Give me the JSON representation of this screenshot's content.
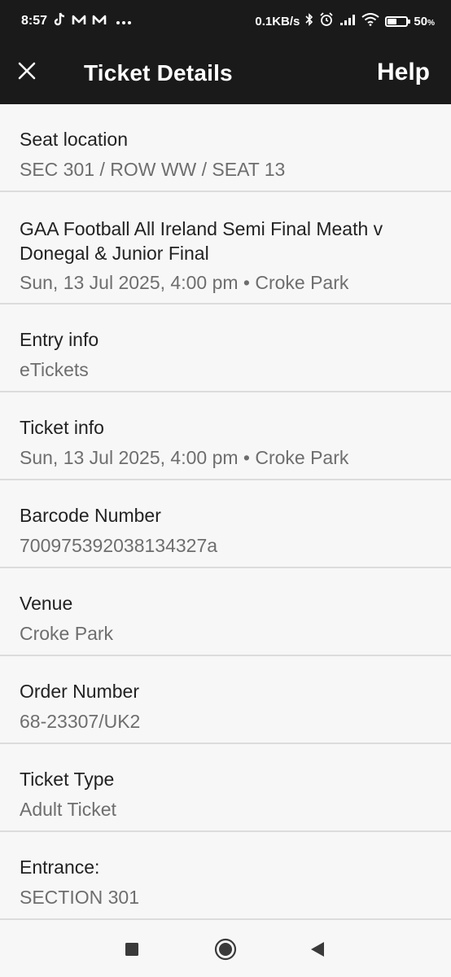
{
  "status_bar": {
    "time": "8:57",
    "network_speed": "0.1KB/s",
    "battery_level": "50",
    "battery_unit": "%",
    "battery_fraction": 0.5,
    "icons": [
      "tiktok-icon",
      "m-app-icon",
      "m-app-icon",
      "more-dots-icon",
      "bluetooth-icon",
      "alarm-icon",
      "signal-icon",
      "wifi-icon",
      "battery-icon"
    ]
  },
  "app_bar": {
    "title": "Ticket Details",
    "help_label": "Help",
    "close_icon": "close-icon"
  },
  "details": [
    {
      "label": "Seat location",
      "value": "SEC 301 / ROW WW / SEAT 13"
    },
    {
      "label": "GAA Football All Ireland Semi Final Meath v Donegal & Junior Final",
      "value": "Sun, 13 Jul 2025, 4:00 pm • Croke Park"
    },
    {
      "label": "Entry info",
      "value": "eTickets"
    },
    {
      "label": "Ticket info",
      "value": "Sun, 13 Jul 2025, 4:00 pm • Croke Park"
    },
    {
      "label": "Barcode Number",
      "value": "700975392038134327a"
    },
    {
      "label": "Venue",
      "value": "Croke Park"
    },
    {
      "label": "Order Number",
      "value": "68-23307/UK2"
    },
    {
      "label": "Ticket Type",
      "value": "Adult Ticket"
    },
    {
      "label": "Entrance:",
      "value": "SECTION 301"
    }
  ],
  "nav_bar": {
    "icons": [
      "recents-square-icon",
      "home-circle-icon",
      "back-triangle-icon"
    ]
  },
  "colors": {
    "bar_background": "#1a1a1a",
    "page_background": "#f7f7f7",
    "label_text": "#222222",
    "value_text": "#6e6e6e",
    "divider": "#dcdcdc"
  }
}
